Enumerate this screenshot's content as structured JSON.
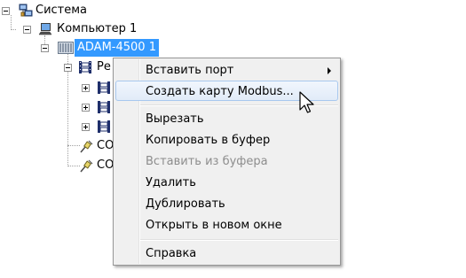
{
  "tree": {
    "root": {
      "label": "Система",
      "icon": "network-system-icon"
    },
    "computer": {
      "label": "Компьютер 1",
      "icon": "computer-icon"
    },
    "device": {
      "label": "ADAM-4500 1",
      "icon": "device-module-icon",
      "selected": true
    },
    "child_partial": {
      "label": "Ре",
      "icon": "register-film-icon"
    },
    "children_hidden": [
      {
        "icon": "register-film-icon"
      },
      {
        "icon": "register-film-icon"
      },
      {
        "icon": "register-film-icon"
      }
    ],
    "ports": [
      {
        "label": "CO",
        "icon": "port-plug-icon"
      },
      {
        "label": "CO",
        "icon": "port-plug-icon"
      }
    ]
  },
  "context_menu": {
    "items": [
      {
        "label": "Вставить порт",
        "has_submenu": true,
        "disabled": false,
        "hovered": false
      },
      {
        "label": "Создать карту Modbus...",
        "has_submenu": false,
        "disabled": false,
        "hovered": true
      },
      {
        "label": "Вырезать",
        "has_submenu": false,
        "disabled": false,
        "hovered": false
      },
      {
        "label": "Копировать в буфер",
        "has_submenu": false,
        "disabled": false,
        "hovered": false
      },
      {
        "label": "Вставить из буфера",
        "has_submenu": false,
        "disabled": true,
        "hovered": false
      },
      {
        "label": "Удалить",
        "has_submenu": false,
        "disabled": false,
        "hovered": false
      },
      {
        "label": "Дублировать",
        "has_submenu": false,
        "disabled": false,
        "hovered": false
      },
      {
        "label": "Открыть в новом окне",
        "has_submenu": false,
        "disabled": false,
        "hovered": false
      },
      {
        "label": "Справка",
        "has_submenu": false,
        "disabled": false,
        "hovered": false
      }
    ]
  },
  "colors": {
    "selection": "#3399ff",
    "menu_background": "#f0f0f0",
    "hover_border": "#a8c8ee",
    "disabled_text": "#8d8d8d"
  },
  "cursor": {
    "icon": "mouse-pointer-icon"
  }
}
